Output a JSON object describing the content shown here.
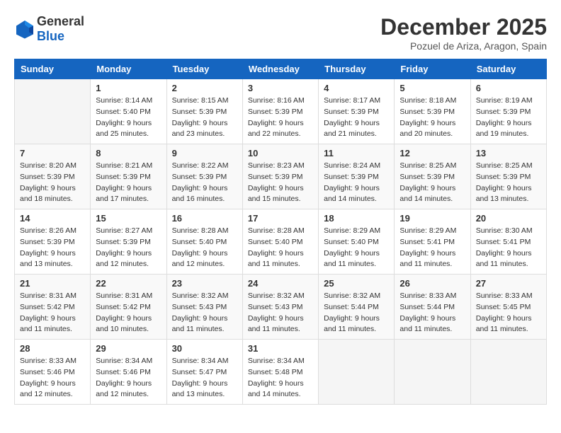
{
  "logo": {
    "general": "General",
    "blue": "Blue"
  },
  "title": "December 2025",
  "location": "Pozuel de Ariza, Aragon, Spain",
  "headers": [
    "Sunday",
    "Monday",
    "Tuesday",
    "Wednesday",
    "Thursday",
    "Friday",
    "Saturday"
  ],
  "weeks": [
    [
      {
        "day": "",
        "info": ""
      },
      {
        "day": "1",
        "info": "Sunrise: 8:14 AM\nSunset: 5:40 PM\nDaylight: 9 hours\nand 25 minutes."
      },
      {
        "day": "2",
        "info": "Sunrise: 8:15 AM\nSunset: 5:39 PM\nDaylight: 9 hours\nand 23 minutes."
      },
      {
        "day": "3",
        "info": "Sunrise: 8:16 AM\nSunset: 5:39 PM\nDaylight: 9 hours\nand 22 minutes."
      },
      {
        "day": "4",
        "info": "Sunrise: 8:17 AM\nSunset: 5:39 PM\nDaylight: 9 hours\nand 21 minutes."
      },
      {
        "day": "5",
        "info": "Sunrise: 8:18 AM\nSunset: 5:39 PM\nDaylight: 9 hours\nand 20 minutes."
      },
      {
        "day": "6",
        "info": "Sunrise: 8:19 AM\nSunset: 5:39 PM\nDaylight: 9 hours\nand 19 minutes."
      }
    ],
    [
      {
        "day": "7",
        "info": "Sunrise: 8:20 AM\nSunset: 5:39 PM\nDaylight: 9 hours\nand 18 minutes."
      },
      {
        "day": "8",
        "info": "Sunrise: 8:21 AM\nSunset: 5:39 PM\nDaylight: 9 hours\nand 17 minutes."
      },
      {
        "day": "9",
        "info": "Sunrise: 8:22 AM\nSunset: 5:39 PM\nDaylight: 9 hours\nand 16 minutes."
      },
      {
        "day": "10",
        "info": "Sunrise: 8:23 AM\nSunset: 5:39 PM\nDaylight: 9 hours\nand 15 minutes."
      },
      {
        "day": "11",
        "info": "Sunrise: 8:24 AM\nSunset: 5:39 PM\nDaylight: 9 hours\nand 14 minutes."
      },
      {
        "day": "12",
        "info": "Sunrise: 8:25 AM\nSunset: 5:39 PM\nDaylight: 9 hours\nand 14 minutes."
      },
      {
        "day": "13",
        "info": "Sunrise: 8:25 AM\nSunset: 5:39 PM\nDaylight: 9 hours\nand 13 minutes."
      }
    ],
    [
      {
        "day": "14",
        "info": "Sunrise: 8:26 AM\nSunset: 5:39 PM\nDaylight: 9 hours\nand 13 minutes."
      },
      {
        "day": "15",
        "info": "Sunrise: 8:27 AM\nSunset: 5:39 PM\nDaylight: 9 hours\nand 12 minutes."
      },
      {
        "day": "16",
        "info": "Sunrise: 8:28 AM\nSunset: 5:40 PM\nDaylight: 9 hours\nand 12 minutes."
      },
      {
        "day": "17",
        "info": "Sunrise: 8:28 AM\nSunset: 5:40 PM\nDaylight: 9 hours\nand 11 minutes."
      },
      {
        "day": "18",
        "info": "Sunrise: 8:29 AM\nSunset: 5:40 PM\nDaylight: 9 hours\nand 11 minutes."
      },
      {
        "day": "19",
        "info": "Sunrise: 8:29 AM\nSunset: 5:41 PM\nDaylight: 9 hours\nand 11 minutes."
      },
      {
        "day": "20",
        "info": "Sunrise: 8:30 AM\nSunset: 5:41 PM\nDaylight: 9 hours\nand 11 minutes."
      }
    ],
    [
      {
        "day": "21",
        "info": "Sunrise: 8:31 AM\nSunset: 5:42 PM\nDaylight: 9 hours\nand 11 minutes."
      },
      {
        "day": "22",
        "info": "Sunrise: 8:31 AM\nSunset: 5:42 PM\nDaylight: 9 hours\nand 10 minutes."
      },
      {
        "day": "23",
        "info": "Sunrise: 8:32 AM\nSunset: 5:43 PM\nDaylight: 9 hours\nand 11 minutes."
      },
      {
        "day": "24",
        "info": "Sunrise: 8:32 AM\nSunset: 5:43 PM\nDaylight: 9 hours\nand 11 minutes."
      },
      {
        "day": "25",
        "info": "Sunrise: 8:32 AM\nSunset: 5:44 PM\nDaylight: 9 hours\nand 11 minutes."
      },
      {
        "day": "26",
        "info": "Sunrise: 8:33 AM\nSunset: 5:44 PM\nDaylight: 9 hours\nand 11 minutes."
      },
      {
        "day": "27",
        "info": "Sunrise: 8:33 AM\nSunset: 5:45 PM\nDaylight: 9 hours\nand 11 minutes."
      }
    ],
    [
      {
        "day": "28",
        "info": "Sunrise: 8:33 AM\nSunset: 5:46 PM\nDaylight: 9 hours\nand 12 minutes."
      },
      {
        "day": "29",
        "info": "Sunrise: 8:34 AM\nSunset: 5:46 PM\nDaylight: 9 hours\nand 12 minutes."
      },
      {
        "day": "30",
        "info": "Sunrise: 8:34 AM\nSunset: 5:47 PM\nDaylight: 9 hours\nand 13 minutes."
      },
      {
        "day": "31",
        "info": "Sunrise: 8:34 AM\nSunset: 5:48 PM\nDaylight: 9 hours\nand 14 minutes."
      },
      {
        "day": "",
        "info": ""
      },
      {
        "day": "",
        "info": ""
      },
      {
        "day": "",
        "info": ""
      }
    ]
  ]
}
